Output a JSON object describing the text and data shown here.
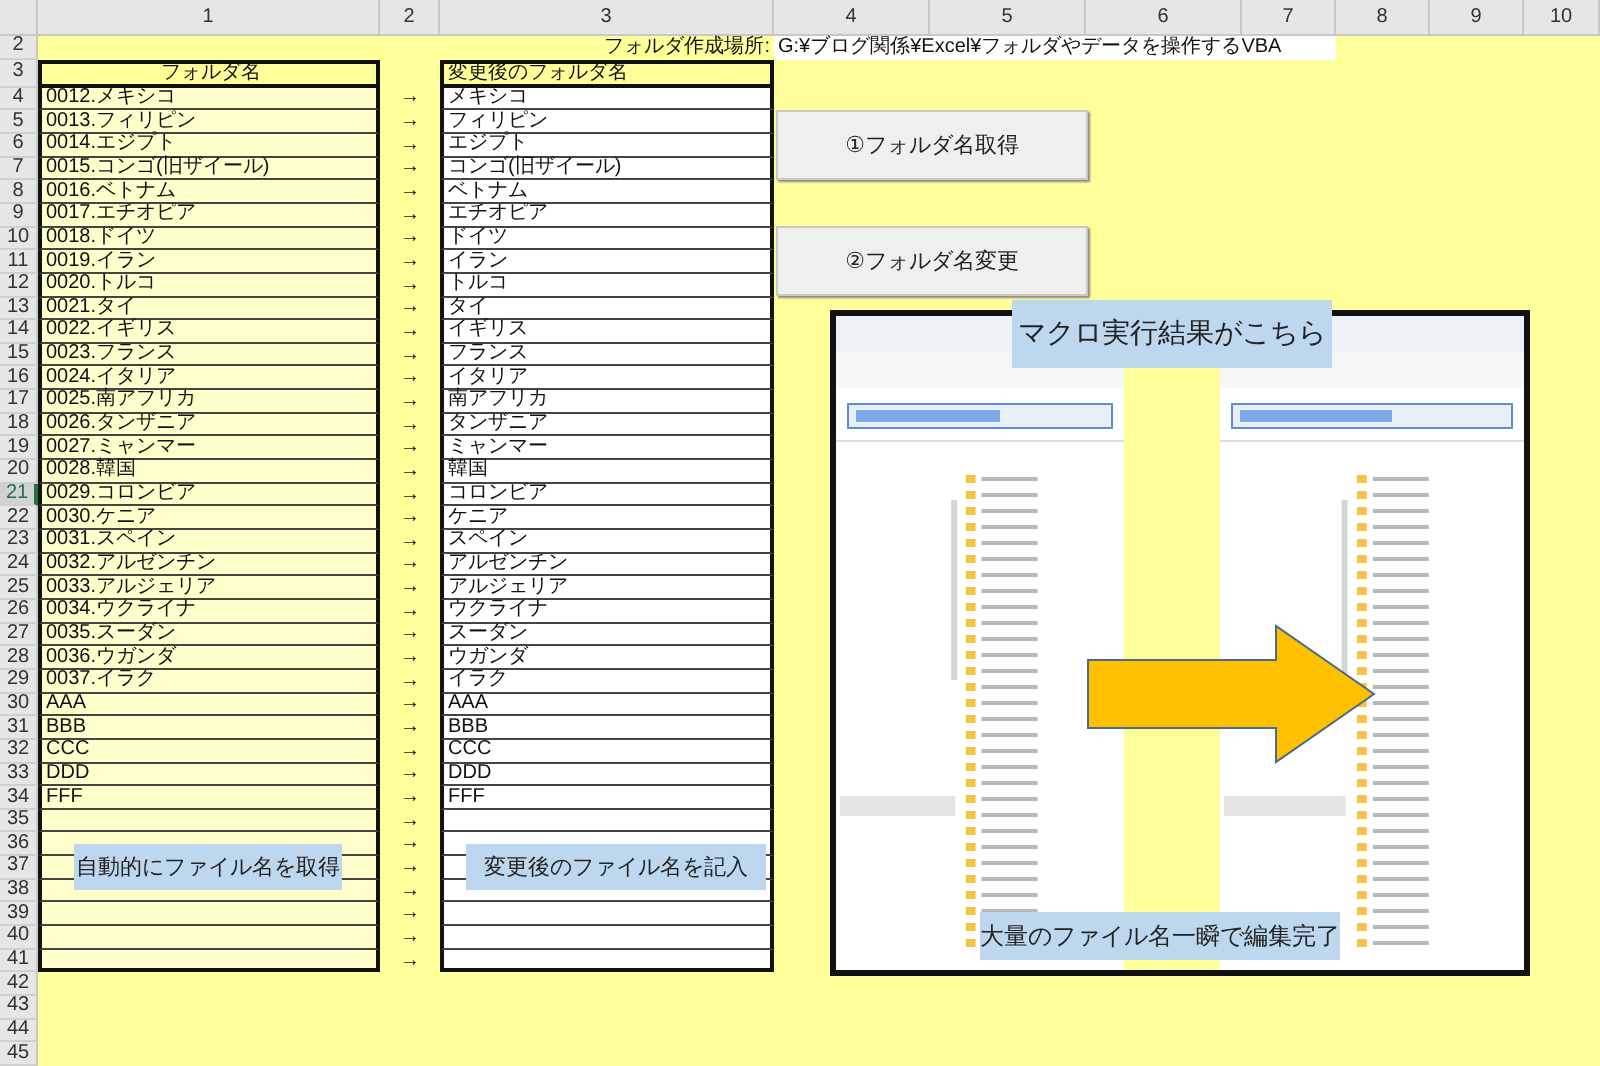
{
  "columns": [
    "1",
    "2",
    "3",
    "4",
    "5",
    "6",
    "7",
    "8",
    "9",
    "10"
  ],
  "row_numbers": [
    {
      "label": "2",
      "selected": false
    },
    {
      "label": "3",
      "selected": false
    },
    {
      "label": "4",
      "selected": false
    },
    {
      "label": "5",
      "selected": false
    },
    {
      "label": "6",
      "selected": false
    },
    {
      "label": "7",
      "selected": false
    },
    {
      "label": "8",
      "selected": false
    },
    {
      "label": "9",
      "selected": false
    },
    {
      "label": "10",
      "selected": false
    },
    {
      "label": "11",
      "selected": false
    },
    {
      "label": "12",
      "selected": false
    },
    {
      "label": "13",
      "selected": false
    },
    {
      "label": "14",
      "selected": false
    },
    {
      "label": "15",
      "selected": false
    },
    {
      "label": "16",
      "selected": false
    },
    {
      "label": "17",
      "selected": false
    },
    {
      "label": "18",
      "selected": false
    },
    {
      "label": "19",
      "selected": false
    },
    {
      "label": "20",
      "selected": false
    },
    {
      "label": "21",
      "selected": true
    },
    {
      "label": "22",
      "selected": false
    },
    {
      "label": "23",
      "selected": false
    },
    {
      "label": "24",
      "selected": false
    },
    {
      "label": "25",
      "selected": false
    },
    {
      "label": "26",
      "selected": false
    },
    {
      "label": "27",
      "selected": false
    },
    {
      "label": "28",
      "selected": false
    },
    {
      "label": "29",
      "selected": false
    },
    {
      "label": "30",
      "selected": false
    },
    {
      "label": "31",
      "selected": false
    },
    {
      "label": "32",
      "selected": false
    },
    {
      "label": "33",
      "selected": false
    },
    {
      "label": "34",
      "selected": false
    },
    {
      "label": "35",
      "selected": false
    },
    {
      "label": "36",
      "selected": false
    },
    {
      "label": "37",
      "selected": false
    },
    {
      "label": "38",
      "selected": false
    },
    {
      "label": "39",
      "selected": false
    },
    {
      "label": "40",
      "selected": false
    },
    {
      "label": "41",
      "selected": false
    },
    {
      "label": "42",
      "selected": false
    },
    {
      "label": "43",
      "selected": false
    },
    {
      "label": "44",
      "selected": false
    },
    {
      "label": "45",
      "selected": false
    }
  ],
  "location": {
    "label": "フォルダ作成場所:",
    "path": "G:¥ブログ関係¥Excel¥フォルダやデータを操作するVBA"
  },
  "table": {
    "headers": [
      "フォルダ名",
      "変更後のフォルダ名"
    ],
    "rows": [
      {
        "before": "0012.メキシコ",
        "arrow": "→",
        "after": "メキシコ"
      },
      {
        "before": "0013.フィリピン",
        "arrow": "→",
        "after": "フィリピン"
      },
      {
        "before": "0014.エジプト",
        "arrow": "→",
        "after": "エジプト"
      },
      {
        "before": "0015.コンゴ(旧ザイール)",
        "arrow": "→",
        "after": "コンゴ(旧ザイール)"
      },
      {
        "before": "0016.ベトナム",
        "arrow": "→",
        "after": "ベトナム"
      },
      {
        "before": "0017.エチオピア",
        "arrow": "→",
        "after": "エチオピア"
      },
      {
        "before": "0018.ドイツ",
        "arrow": "→",
        "after": "ドイツ"
      },
      {
        "before": "0019.イラン",
        "arrow": "→",
        "after": "イラン"
      },
      {
        "before": "0020.トルコ",
        "arrow": "→",
        "after": "トルコ"
      },
      {
        "before": "0021.タイ",
        "arrow": "→",
        "after": "タイ"
      },
      {
        "before": "0022.イギリス",
        "arrow": "→",
        "after": "イギリス"
      },
      {
        "before": "0023.フランス",
        "arrow": "→",
        "after": "フランス"
      },
      {
        "before": "0024.イタリア",
        "arrow": "→",
        "after": "イタリア"
      },
      {
        "before": "0025.南アフリカ",
        "arrow": "→",
        "after": "南アフリカ"
      },
      {
        "before": "0026.タンザニア",
        "arrow": "→",
        "after": "タンザニア"
      },
      {
        "before": "0027.ミャンマー",
        "arrow": "→",
        "after": "ミャンマー"
      },
      {
        "before": "0028.韓国",
        "arrow": "→",
        "after": "韓国"
      },
      {
        "before": "0029.コロンビア",
        "arrow": "→",
        "after": "コロンビア"
      },
      {
        "before": "0030.ケニア",
        "arrow": "→",
        "after": "ケニア"
      },
      {
        "before": "0031.スペイン",
        "arrow": "→",
        "after": "スペイン"
      },
      {
        "before": "0032.アルゼンチン",
        "arrow": "→",
        "after": "アルゼンチン"
      },
      {
        "before": "0033.アルジェリア",
        "arrow": "→",
        "after": "アルジェリア"
      },
      {
        "before": "0034.ウクライナ",
        "arrow": "→",
        "after": "ウクライナ"
      },
      {
        "before": "0035.スーダン",
        "arrow": "→",
        "after": "スーダン"
      },
      {
        "before": "0036.ウガンダ",
        "arrow": "→",
        "after": "ウガンダ"
      },
      {
        "before": "0037.イラク",
        "arrow": "→",
        "after": "イラク"
      },
      {
        "before": "AAA",
        "arrow": "→",
        "after": "AAA"
      },
      {
        "before": "BBB",
        "arrow": "→",
        "after": "BBB"
      },
      {
        "before": "CCC",
        "arrow": "→",
        "after": "CCC"
      },
      {
        "before": "DDD",
        "arrow": "→",
        "after": "DDD"
      },
      {
        "before": "FFF",
        "arrow": "→",
        "after": "FFF"
      },
      {
        "arrow": "→"
      },
      {
        "arrow": "→"
      },
      {
        "arrow": "→"
      },
      {
        "arrow": "→"
      },
      {
        "arrow": "→"
      },
      {
        "arrow": "→"
      },
      {
        "arrow": "→"
      }
    ]
  },
  "buttons": [
    "①フォルダ名取得",
    "②フォルダ名変更"
  ],
  "notes": [
    "自動的にファイル名を取得",
    "変更後のファイル名を記入",
    "マクロ実行結果がこちら",
    "大量のファイル名一瞬で編集完了"
  ]
}
